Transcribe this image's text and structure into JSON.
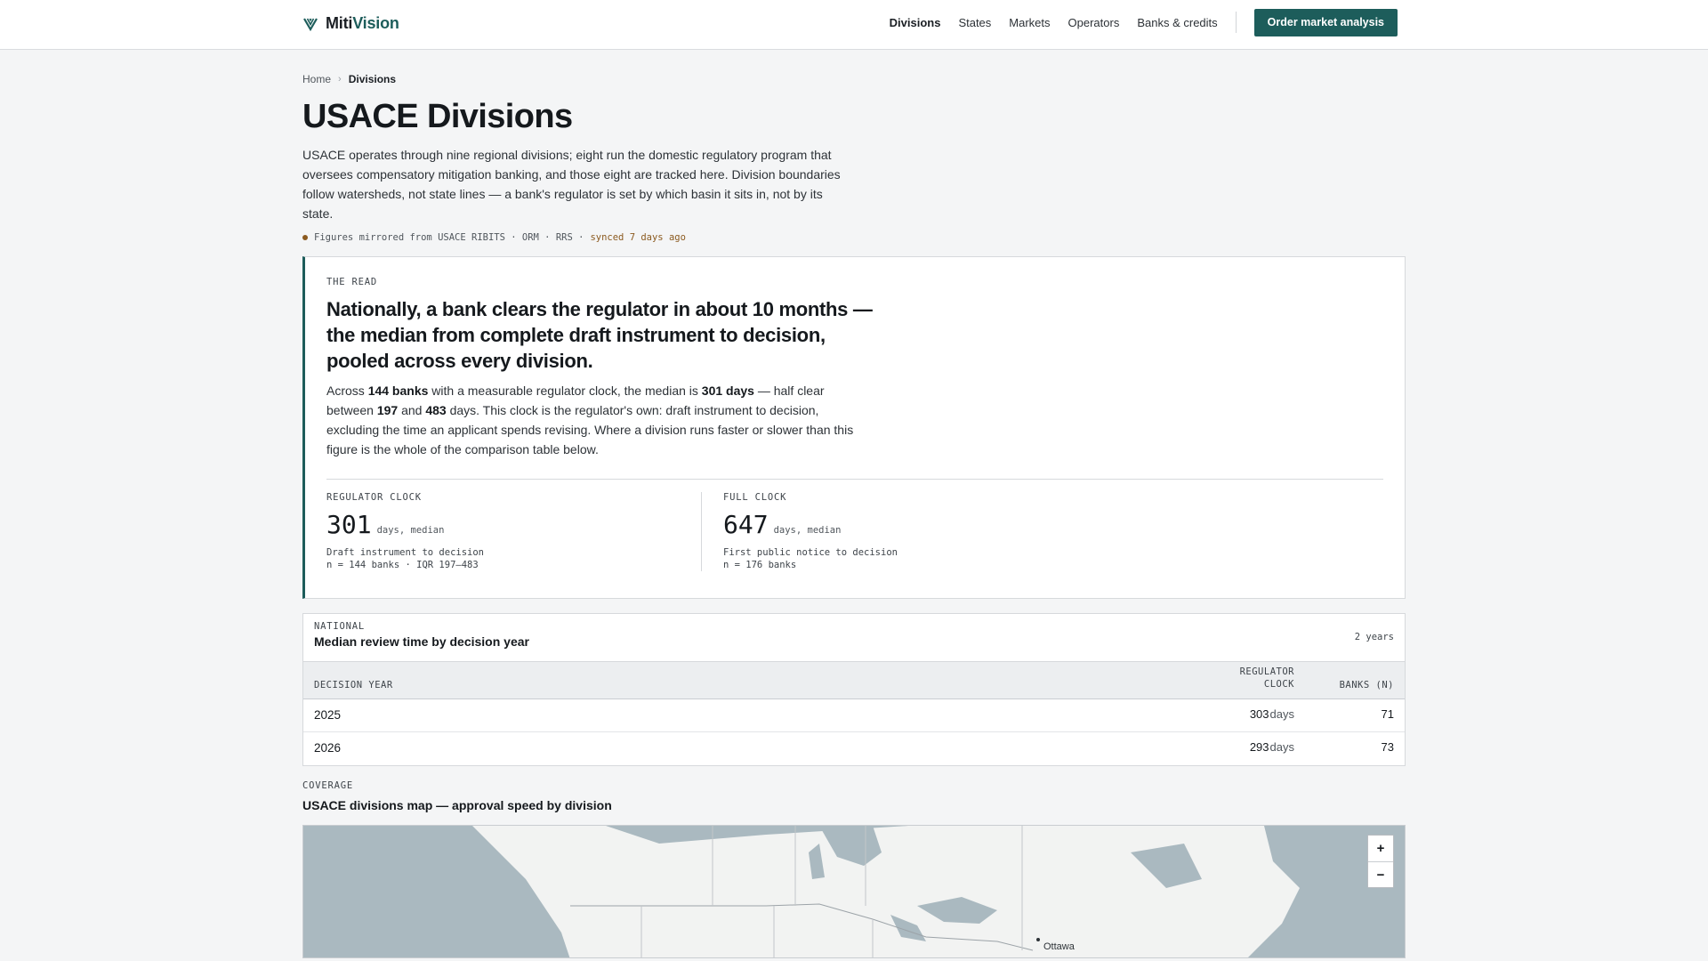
{
  "brand": {
    "prefix": "Miti",
    "suffix": "Vision",
    "icon": "leaf-chevron-icon"
  },
  "nav": {
    "items": [
      {
        "label": "Divisions",
        "active": true
      },
      {
        "label": "States"
      },
      {
        "label": "Markets"
      },
      {
        "label": "Operators"
      },
      {
        "label": "Banks & credits"
      }
    ],
    "cta_label": "Order market analysis"
  },
  "breadcrumb": {
    "home": "Home",
    "current": "Divisions"
  },
  "page": {
    "title": "USACE Divisions",
    "intro": "USACE operates through nine regional divisions; eight run the domestic regulatory program that oversees compensatory mitigation banking, and those eight are tracked here. Division boundaries follow watersheds, not state lines — a bank's regulator is set by which basin it sits in, not by its state.",
    "sync_source": "Figures mirrored from USACE RIBITS · ORM · RRS ·",
    "sync_age": "synced 7 days ago"
  },
  "read": {
    "eyebrow": "THE READ",
    "headline": "Nationally, a bank clears the regulator in about 10 months — the median from complete draft instrument to decision, pooled across every division.",
    "body": {
      "p1": "Across ",
      "banks": "144 banks",
      "p2": " with a measurable regulator clock, the median is ",
      "days": "301 days",
      "p3": " — half clear between ",
      "low": "197",
      "p4": " and ",
      "high": "483",
      "p5": " days. This clock is the regulator's own: draft instrument to decision, excluding the time an applicant spends revising. Where a division runs faster or slower than this figure is the whole of the comparison table below."
    },
    "stats": [
      {
        "label": "REGULATOR CLOCK",
        "value": "301",
        "unit": "days, median",
        "desc": "Draft instrument to decision",
        "n": "n = 144 banks · IQR 197–483"
      },
      {
        "label": "FULL CLOCK",
        "value": "647",
        "unit": "days, median",
        "desc": "First public notice to decision",
        "n": "n = 176 banks"
      }
    ]
  },
  "national": {
    "eyebrow": "NATIONAL",
    "title": "Median review time by decision year",
    "meta": "2 years",
    "headers": {
      "year": "DECISION YEAR",
      "clock_1": "REGULATOR",
      "clock_2": "CLOCK",
      "n": "BANKS (N)"
    },
    "rows": [
      {
        "year": "2025",
        "clock": "303",
        "unit": "days",
        "n": "71"
      },
      {
        "year": "2026",
        "clock": "293",
        "unit": "days",
        "n": "73"
      }
    ]
  },
  "coverage": {
    "eyebrow": "COVERAGE",
    "title": "USACE divisions map — approval speed by division",
    "zoom_in": "+",
    "zoom_out": "−",
    "place_label": "Ottawa"
  }
}
